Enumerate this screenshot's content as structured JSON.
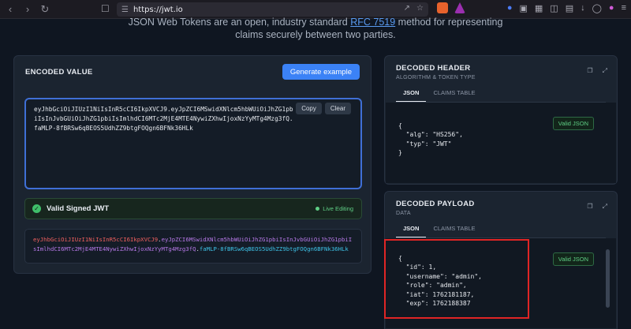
{
  "browser": {
    "url": "https://jwt.io",
    "icons": [
      "back-icon",
      "forward-icon",
      "refresh-icon",
      "bookmark-icon",
      "tracking-icon",
      "share-icon",
      "star-icon"
    ]
  },
  "intro": {
    "line1_a": "JSON Web Tokens are an open, industry standard ",
    "rfc_link": "RFC 7519",
    "line1_b": " method for representing",
    "line2": "claims securely between two parties."
  },
  "encoded": {
    "title": "ENCODED VALUE",
    "generate_button": "Generate example",
    "copy_button": "Copy",
    "clear_button": "Clear",
    "token": "eyJhbGciOiJIUzI1NiIsInR5cCI6IkpXVCJ9.eyJpZCI6MSwidXNlcm5hbWUiOiJhZG1pbiIsInJvbGUiOiJhZG1pbiIsImlhdCI6MTc2MjE4MTE4NywiZXhwIjoxNzYyMTg4Mzg3fQ.faMLP-8fBRSw6qBEOS5UdhZZ9btgFOQgn6BFNk36HLk",
    "status": "Valid Signed JWT",
    "live_editing": "Live Editing",
    "parts": {
      "header": "eyJhbGciOiJIUzI1NiIsInR5cCI6IkpXVCJ9",
      "payload": "eyJpZCI6MSwidXNlcm5hbWUiOiJhZG1pbiIsInJvbGUiOiJhZG1pbiIsImlhdCI6MTc2MjE4MTE4NywiZXhwIjoxNzYyMTg4Mzg3fQ",
      "signature": "faMLP-8fBRSw6qBEOS5UdhZZ9btgFOQgn6BFNk36HLk"
    }
  },
  "decoded_header": {
    "title": "DECODED HEADER",
    "subtitle": "ALGORITHM & TOKEN TYPE",
    "tab_json": "JSON",
    "tab_claims": "CLAIMS TABLE",
    "valid": "Valid JSON",
    "code": "{\n  \"alg\": \"HS256\",\n  \"typ\": \"JWT\"\n}"
  },
  "decoded_payload": {
    "title": "DECODED PAYLOAD",
    "subtitle": "DATA",
    "tab_json": "JSON",
    "tab_claims": "CLAIMS TABLE",
    "valid": "Valid JSON",
    "code": "{\n  \"id\": 1,\n  \"username\": \"admin\",\n  \"role\": \"admin\",\n  \"iat\": 1762181187,\n  \"exp\": 1762188387"
  },
  "colors": {
    "accent": "#3b82f6",
    "valid": "#5fcf85",
    "highlight": "#e02525",
    "token_header": "#f0605f",
    "token_payload": "#b779e8",
    "token_signature": "#3ec3e8"
  }
}
